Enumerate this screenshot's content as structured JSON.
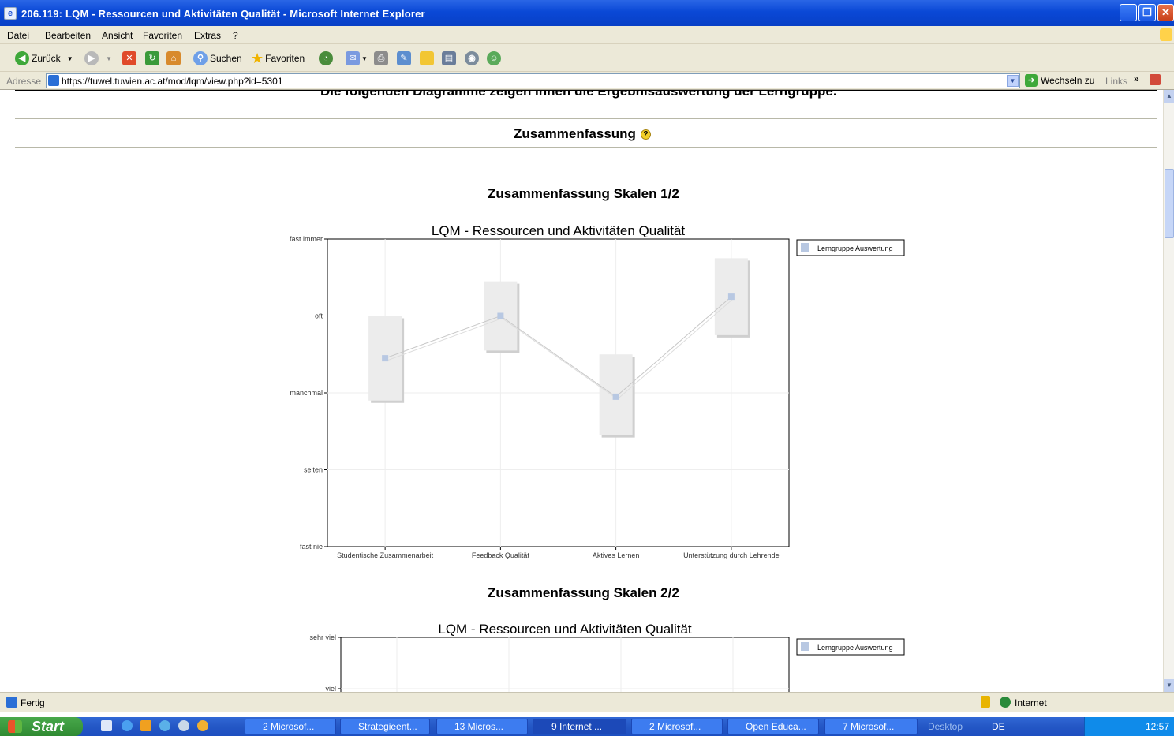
{
  "window": {
    "title": "206.119: LQM - Ressourcen und Aktivitäten Qualität - Microsoft Internet Explorer"
  },
  "menu": [
    "Datei",
    "Bearbeiten",
    "Ansicht",
    "Favoriten",
    "Extras",
    "?"
  ],
  "toolbar": {
    "back": "Zurück",
    "search": "Suchen",
    "favorites": "Favoriten"
  },
  "address": {
    "label": "Adresse",
    "url": "https://tuwel.tuwien.ac.at/mod/lqm/view.php?id=5301",
    "go": "Wechseln zu",
    "links": "Links"
  },
  "page": {
    "cutoff_text": "Die folgenden Diagramme zeigen Ihnen die Ergebnisauswertung der Lerngruppe.",
    "section_title": "Zusammenfassung",
    "help_icon": "question-circle-icon",
    "chart1_heading": "Zusammenfassung Skalen 1/2",
    "chart2_heading": "Zusammenfassung Skalen 2/2"
  },
  "chart_data": [
    {
      "type": "line",
      "title": "LQM - Ressourcen und Aktivitäten Qualität",
      "categories": [
        "Studentische Zusammenarbeit",
        "Feedback Qualität",
        "Aktives Lernen",
        "Unterstützung durch Lehrende"
      ],
      "y_tick_labels": [
        "fast nie",
        "selten",
        "manchmal",
        "oft",
        "fast immer"
      ],
      "ylim": [
        1,
        5
      ],
      "series": [
        {
          "name": "Lerngruppe Auswertung",
          "values": [
            3.45,
            4.0,
            2.95,
            4.25
          ],
          "range_low": [
            2.9,
            3.55,
            2.45,
            3.75
          ],
          "range_high": [
            4.0,
            4.45,
            3.5,
            4.75
          ]
        }
      ],
      "legend": "right",
      "grid": true,
      "colors": {
        "marker": "#b8c8e2",
        "box": "#ececec",
        "line": "#c8c8c8"
      }
    },
    {
      "type": "line",
      "title": "LQM - Ressourcen und Aktivitäten Qualität",
      "y_tick_labels": [
        "viel",
        "sehr viel"
      ],
      "series": [
        {
          "name": "Lerngruppe Auswertung",
          "values": []
        }
      ],
      "legend": "right",
      "grid": true
    }
  ],
  "status": {
    "text": "Fertig",
    "zone": "Internet"
  },
  "taskbar": {
    "start": "Start",
    "tasks": [
      "2 Microsof...",
      "Strategieent...",
      "13 Micros...",
      "9 Internet ...",
      "2 Microsof...",
      "Open Educa...",
      "7 Microsof..."
    ],
    "desktop": "Desktop",
    "lang": "DE",
    "clock": "12:57"
  }
}
